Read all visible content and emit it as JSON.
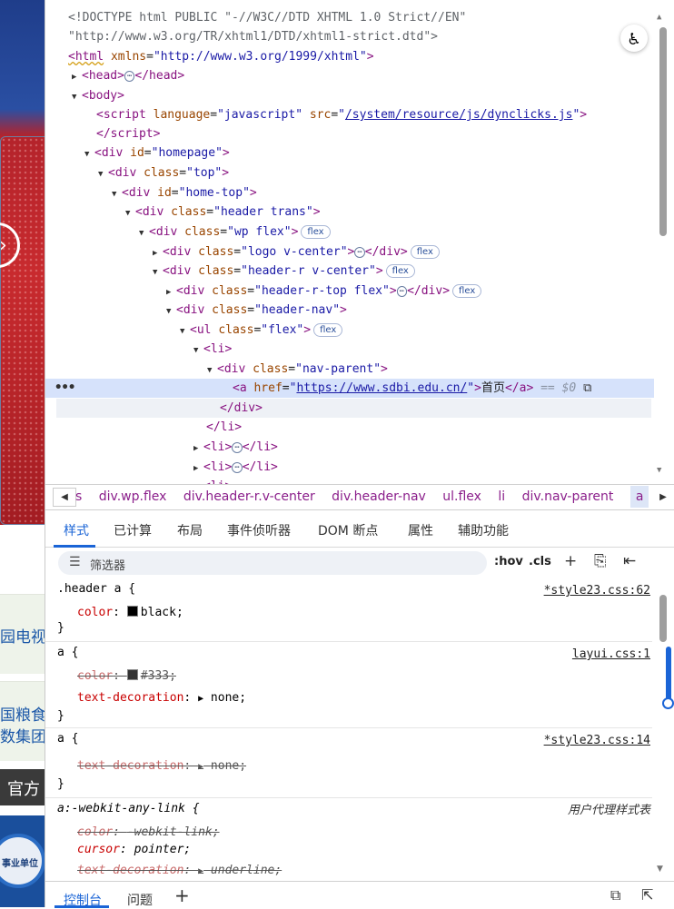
{
  "website": {
    "tile_1": "园电视",
    "tile_2a": "国粮食行",
    "tile_2b": "数集团",
    "official": "官方",
    "badge": "事业单位"
  },
  "elements": {
    "doctype_1": "<!DOCTYPE html PUBLIC \"-//W3C//DTD XHTML 1.0 Strict//EN\"",
    "doctype_2": "\"http://www.w3.org/TR/xhtml1/DTD/xhtml1-strict.dtd\">",
    "html_xmlns": "http://www.w3.org/1999/xhtml",
    "script_language": "javascript",
    "script_src": "/system/resource/js/dynclicks.js",
    "div_homepage_id": "homepage",
    "div_top_class": "top",
    "div_hometop_id": "home-top",
    "div_header_class": "header trans",
    "div_wp_class": "wp flex",
    "div_logo_class": "logo v-center",
    "div_header_r_class": "header-r v-center",
    "div_header_r_top_class": "header-r-top flex",
    "div_header_nav_class": "header-nav",
    "ul_class": "flex",
    "nav_parent_class": "nav-parent",
    "a_href": "https://www.sdbi.edu.cn/",
    "a_text": "首页",
    "dollar_zero": "== $0",
    "flex_badge": "flex",
    "ellipsis": "⋯"
  },
  "breadcrumbs": [
    "s",
    "div.wp.flex",
    "div.header-r.v-center",
    "div.header-nav",
    "ul.flex",
    "li",
    "div.nav-parent",
    "a"
  ],
  "subtabs": [
    "样式",
    "已计算",
    "布局",
    "事件侦听器",
    "DOM 断点",
    "属性",
    "辅助功能"
  ],
  "filter": {
    "placeholder": "筛选器",
    "hov": ":hov",
    "cls": ".cls"
  },
  "rules": [
    {
      "selector": ".header a {",
      "source": "*style23.css:62",
      "props": [
        {
          "name": "color",
          "value": "black",
          "swatch": "#000000",
          "strike": false
        }
      ]
    },
    {
      "selector": "a {",
      "source": "layui.css:1",
      "props": [
        {
          "name": "color",
          "value": "#333;",
          "swatch": "#333333",
          "strike": true
        },
        {
          "name": "text-decoration",
          "value": "none;",
          "strike": false
        }
      ]
    },
    {
      "selector": "a {",
      "source": "*style23.css:14",
      "props": [
        {
          "name": "text-decoration",
          "value": "none;",
          "strike": true
        }
      ]
    },
    {
      "selector": "a:-webkit-any-link {",
      "source": "用户代理样式表",
      "props": [
        {
          "name": "color",
          "value": "-webkit-link;",
          "strike": true
        },
        {
          "name": "cursor",
          "value": "pointer;",
          "strike": false
        },
        {
          "name": "text-decoration",
          "value": "underline;",
          "strike": true
        }
      ]
    }
  ],
  "drawer": {
    "console": "控制台",
    "issues": "问题"
  }
}
